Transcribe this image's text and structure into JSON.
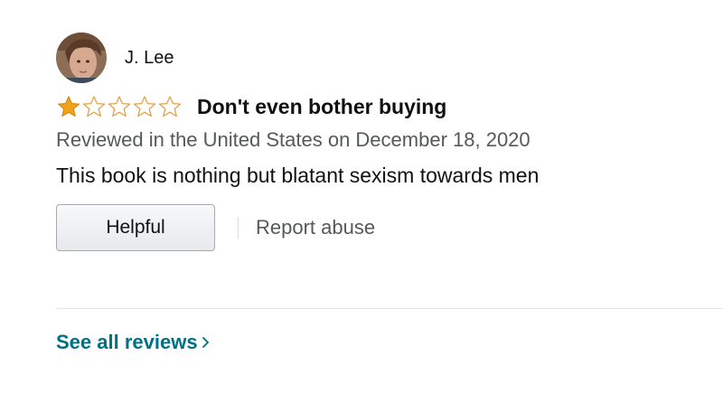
{
  "review": {
    "reviewer_name": "J. Lee",
    "rating": 1,
    "max_rating": 5,
    "title": "Don't even bother buying",
    "date_line": "Reviewed in the United States on December 18, 2020",
    "body": "This book is nothing but blatant sexism towards men",
    "helpful_label": "Helpful",
    "report_label": "Report abuse"
  },
  "footer": {
    "see_all_label": "See all reviews"
  },
  "colors": {
    "star_filled": "#f0a31b",
    "star_empty_outline": "#e3a24a",
    "link": "#007185",
    "muted_text": "#565959"
  },
  "icons": {
    "avatar": "reviewer-photo",
    "star": "star-icon",
    "chevron": "chevron-right-icon"
  }
}
